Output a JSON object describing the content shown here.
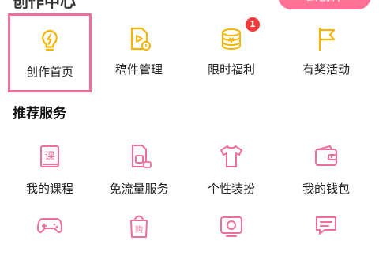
{
  "header": {
    "title": "创作中心",
    "create_button": "去创作"
  },
  "creator_tools": [
    {
      "label": "创作首页",
      "icon": "lightbulb-icon"
    },
    {
      "label": "稿件管理",
      "icon": "video-file-icon"
    },
    {
      "label": "限时福利",
      "icon": "coins-icon",
      "badge": "1"
    },
    {
      "label": "有奖活动",
      "icon": "flag-icon"
    }
  ],
  "services": {
    "title": "推荐服务",
    "items": [
      {
        "label": "我的课程",
        "icon": "course-icon"
      },
      {
        "label": "免流量服务",
        "icon": "sim-card-icon"
      },
      {
        "label": "个性装扮",
        "icon": "tshirt-icon"
      },
      {
        "label": "我的钱包",
        "icon": "wallet-icon"
      },
      {
        "label": "",
        "icon": "gamepad-icon"
      },
      {
        "label": "",
        "icon": "shopping-bag-icon"
      },
      {
        "label": "",
        "icon": "tv-icon"
      },
      {
        "label": "",
        "icon": "chat-icon"
      }
    ]
  },
  "colors": {
    "accent_yellow": "#f5b400",
    "accent_pink": "#ee6f9c",
    "badge_red": "#f23b3b",
    "create_button": "#ff6f96"
  }
}
